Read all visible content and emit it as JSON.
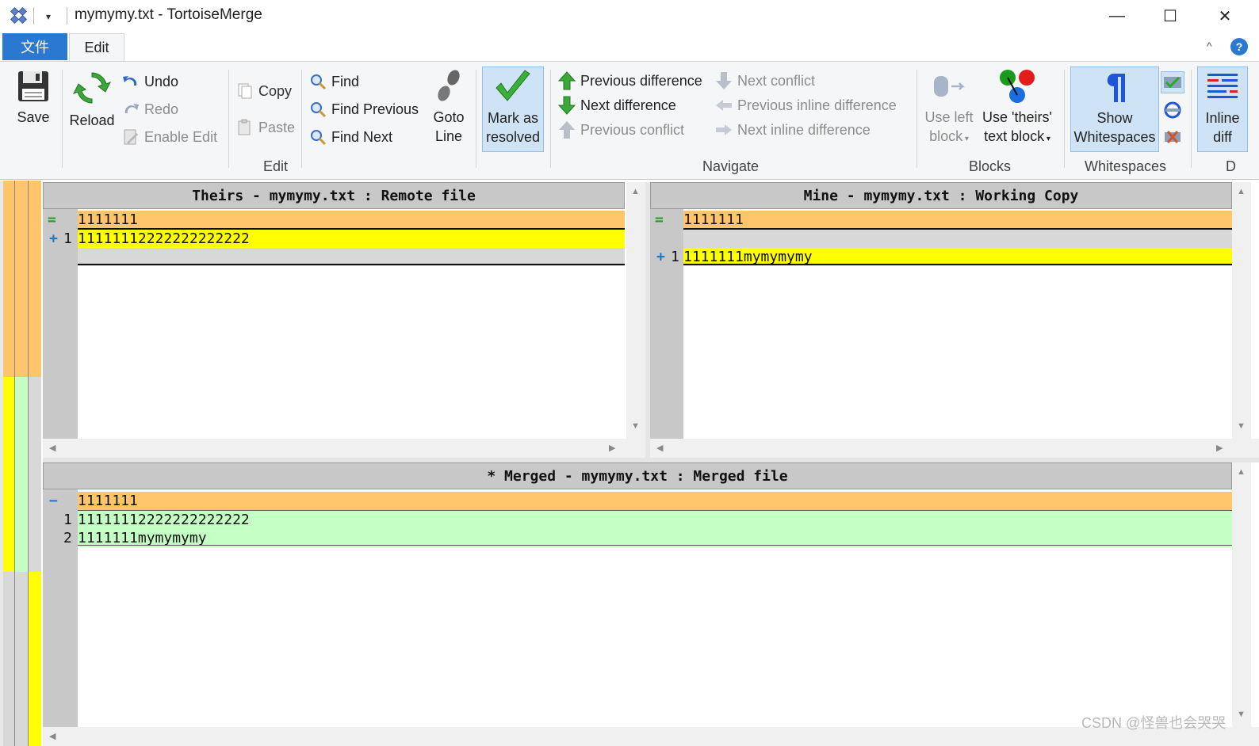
{
  "window": {
    "title": "mymymy.txt - TortoiseMerge",
    "qat_dropdown": "▾",
    "minimize": "—",
    "maximize": "☐",
    "close": "✕"
  },
  "tabs": {
    "file": "文件",
    "edit": "Edit",
    "collapse": "^",
    "help": "?"
  },
  "ribbon": {
    "save": "Save",
    "reload": "Reload",
    "undo": "Undo",
    "redo": "Redo",
    "enable_edit": "Enable Edit",
    "copy": "Copy",
    "paste": "Paste",
    "find": "Find",
    "find_previous": "Find Previous",
    "find_next": "Find Next",
    "goto_line_1": "Goto",
    "goto_line_2": "Line",
    "mark_resolved_1": "Mark as",
    "mark_resolved_2": "resolved",
    "edit_group": "Edit",
    "prev_diff": "Previous difference",
    "next_diff": "Next difference",
    "prev_conflict": "Previous conflict",
    "next_conflict": "Next conflict",
    "prev_inline": "Previous inline difference",
    "next_inline": "Next inline difference",
    "navigate_group": "Navigate",
    "use_left_1": "Use left",
    "use_left_2": "block",
    "use_theirs_1": "Use 'theirs'",
    "use_theirs_2": "text block",
    "blocks_group": "Blocks",
    "show_ws_1": "Show",
    "show_ws_2": "Whitespaces",
    "whitespaces_group": "Whitespaces",
    "inline_1": "Inline",
    "inline_2": "diff",
    "d_group": "D"
  },
  "theirs": {
    "header": "Theirs - mymymy.txt : Remote file",
    "lines": [
      {
        "mark": "=",
        "num": "",
        "text": "1111111"
      },
      {
        "mark": "+",
        "num": "1",
        "text": "11111112222222222222"
      },
      {
        "mark": "",
        "num": "",
        "text": ""
      }
    ]
  },
  "mine": {
    "header": "Mine - mymymy.txt : Working Copy",
    "lines": [
      {
        "mark": "=",
        "num": "",
        "text": "1111111"
      },
      {
        "mark": "",
        "num": "",
        "text": ""
      },
      {
        "mark": "+",
        "num": "1",
        "text": "1111111mymymymy"
      }
    ]
  },
  "merged": {
    "header": "* Merged - mymymy.txt : Merged file",
    "lines": [
      {
        "mark": "−",
        "num": "",
        "text": "1111111"
      },
      {
        "mark": "",
        "num": "1",
        "text": "11111112222222222222"
      },
      {
        "mark": "",
        "num": "2",
        "text": "1111111mymymymy"
      }
    ]
  },
  "colors": {
    "equal_line": "#ffc56b",
    "added_line": "#ffff00",
    "empty_line": "#d8d8d8",
    "merged_line": "#c4ffc4",
    "gutter": "#c8c8c8",
    "accent": "#2b78d0"
  },
  "watermark": "CSDN @怪兽也会哭哭"
}
